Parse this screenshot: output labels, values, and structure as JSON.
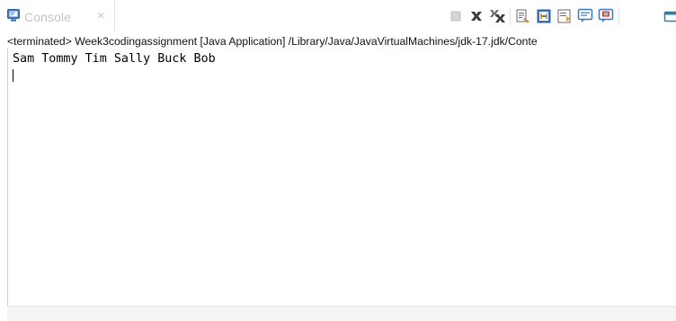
{
  "tab": {
    "title": "Console",
    "close_glyph": "×",
    "icon": "console-icon"
  },
  "toolbar": {
    "buttons": [
      {
        "name": "terminate-button",
        "icon": "stop-icon",
        "enabled": false
      },
      {
        "name": "remove-launch-button",
        "icon": "remove-x-icon"
      },
      {
        "name": "remove-all-terminated-button",
        "icon": "remove-all-x-icon"
      },
      {
        "name": "clear-console-button",
        "icon": "clear-console-icon"
      },
      {
        "name": "scroll-lock-button",
        "icon": "scroll-lock-icon"
      },
      {
        "name": "word-wrap-button",
        "icon": "word-wrap-icon"
      },
      {
        "name": "show-on-stdout-button",
        "icon": "stdout-icon"
      },
      {
        "name": "show-on-stderr-button",
        "icon": "stderr-icon"
      },
      {
        "name": "open-console-button",
        "icon": "open-console-icon"
      }
    ]
  },
  "console": {
    "status_line": "<terminated> Week3codingassignment [Java Application] /Library/Java/JavaVirtualMachines/jdk-17.jdk/Conte",
    "output": "Sam Tommy Tim Sally Buck Bob"
  }
}
